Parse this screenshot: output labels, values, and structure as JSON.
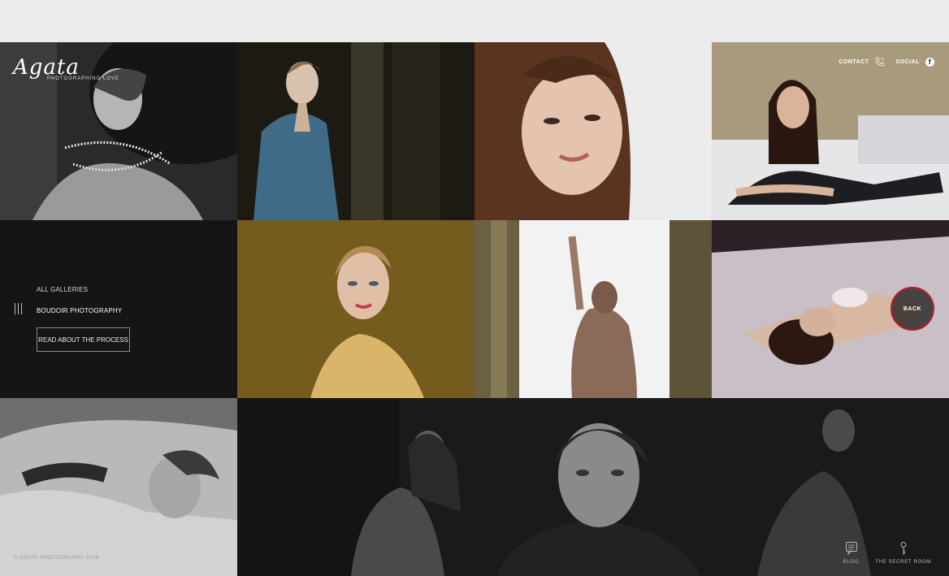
{
  "brand": {
    "name": "Agata",
    "tagline": "PHOTOGRAPHING LOVE"
  },
  "top_nav": {
    "contact_label": "CONTACT",
    "social_label": "SOCIAL",
    "contact_icon": "phone-icon",
    "social_icon": "facebook-icon"
  },
  "side_menu": {
    "all_galleries": "ALL GALLERIES",
    "current_gallery": "BOUDOIR PHOTOGRAPHY",
    "process_button": "READ ABOUT THE PROCESS",
    "menu_icon": "menu-icon"
  },
  "back_button": {
    "label": "BACK",
    "border_color": "#b51c2c"
  },
  "footer": {
    "copyright": "© AGATA PHOTOGRAPHY 2016",
    "blog_label": "BLOG",
    "blog_icon": "chat-icon",
    "secret_label": "THE SECRET ROOM",
    "secret_icon": "key-icon"
  },
  "colors": {
    "page_bg": "#111111",
    "menu_bg": "#151516",
    "accent": "#b51c2c"
  }
}
